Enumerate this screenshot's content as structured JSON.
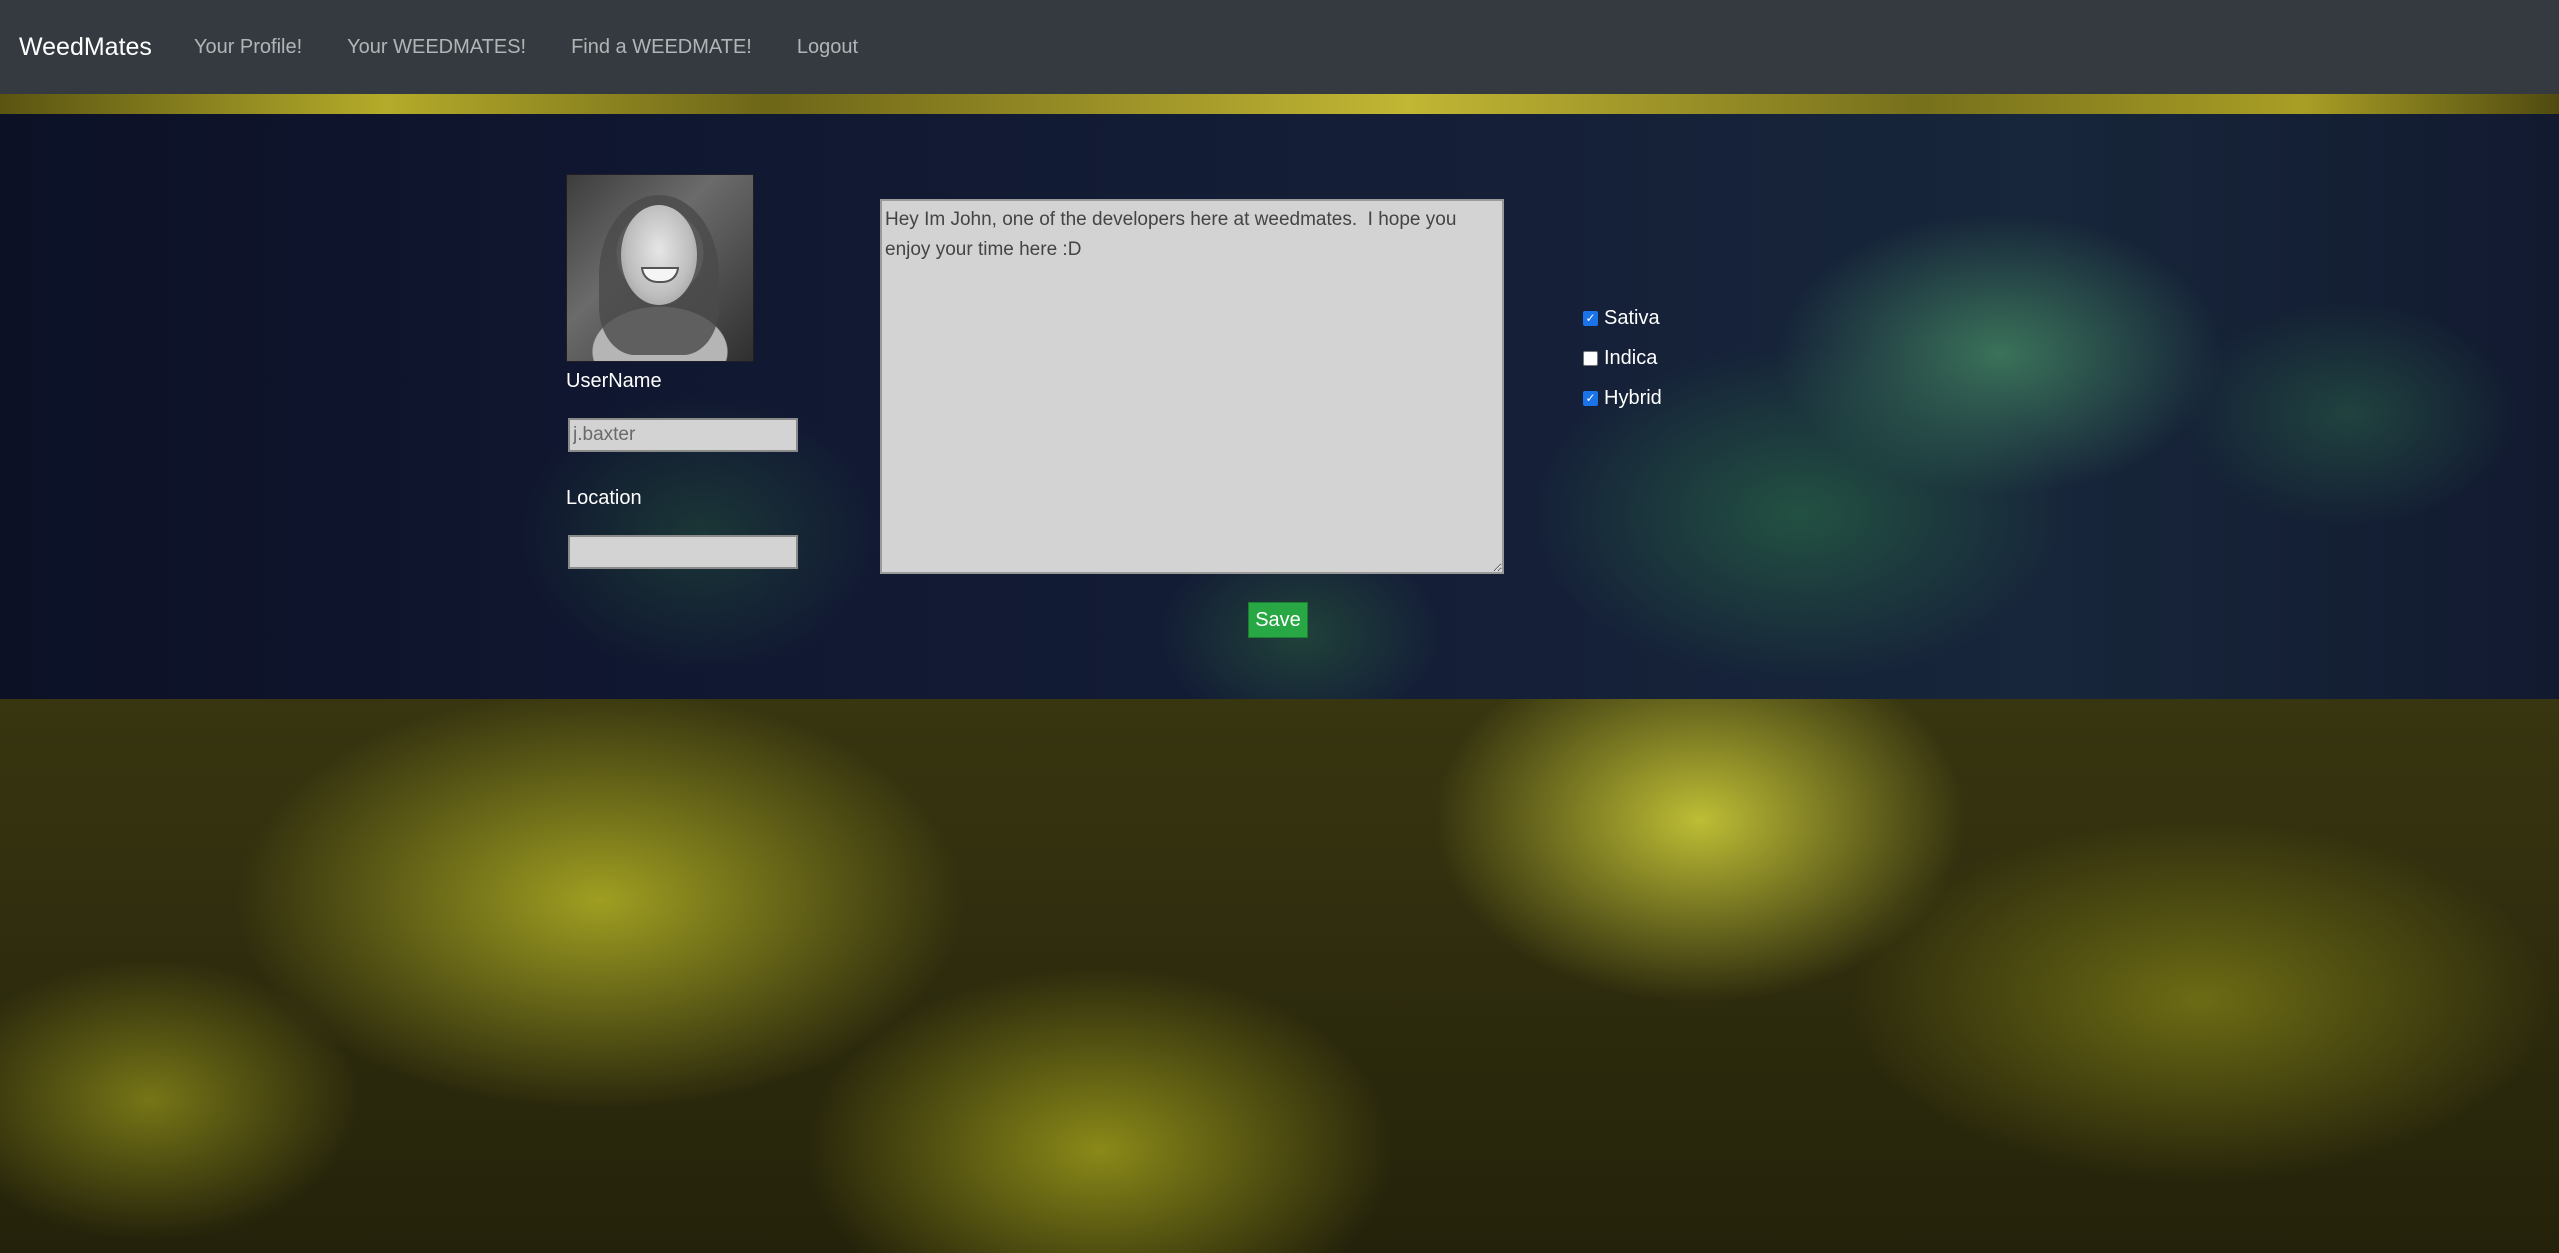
{
  "navbar": {
    "brand": "WeedMates",
    "links": [
      "Your Profile!",
      "Your WEEDMATES!",
      "Find a WEEDMATE!",
      "Logout"
    ]
  },
  "profile": {
    "username_label": "UserName",
    "username_placeholder": "j.baxter",
    "location_label": "Location",
    "location_value": "",
    "bio": "Hey Im John, one of the developers here at weedmates.  I hope you enjoy your time here :D",
    "strains": [
      {
        "label": "Sativa",
        "checked": true
      },
      {
        "label": "Indica",
        "checked": false
      },
      {
        "label": "Hybrid",
        "checked": true
      }
    ],
    "save_label": "Save"
  },
  "colors": {
    "navbar_bg": "#343a40",
    "save_button": "#28a745",
    "checkbox_checked": "#1a73e8",
    "input_bg": "#d3d3d3"
  },
  "icons": {
    "checked": "checkmark-icon"
  }
}
